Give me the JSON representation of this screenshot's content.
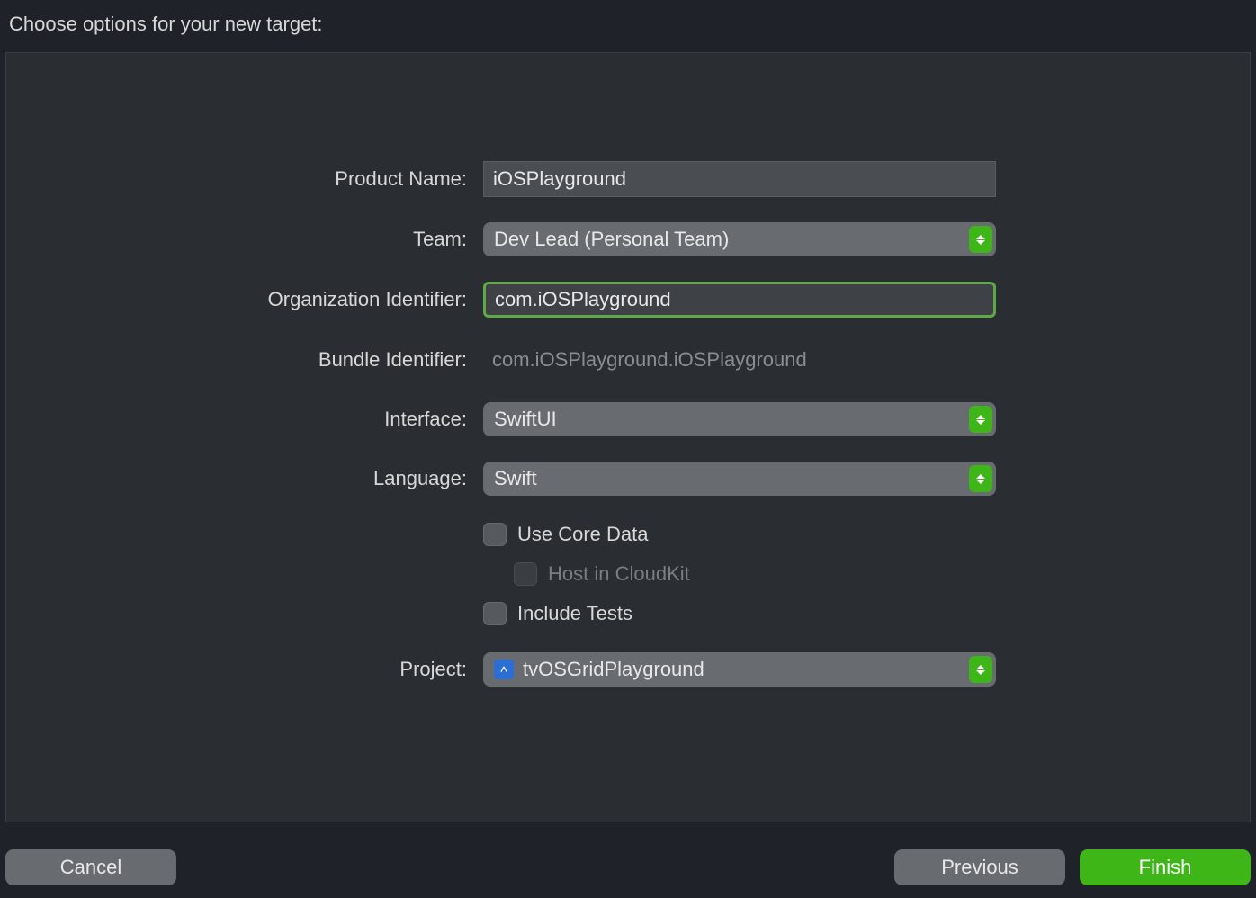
{
  "header": {
    "title": "Choose options for your new target:"
  },
  "form": {
    "productName": {
      "label": "Product Name:",
      "value": "iOSPlayground"
    },
    "team": {
      "label": "Team:",
      "value": "Dev Lead (Personal Team)"
    },
    "orgId": {
      "label": "Organization Identifier:",
      "value": "com.iOSPlayground"
    },
    "bundleId": {
      "label": "Bundle Identifier:",
      "value": "com.iOSPlayground.iOSPlayground"
    },
    "interface": {
      "label": "Interface:",
      "value": "SwiftUI"
    },
    "language": {
      "label": "Language:",
      "value": "Swift"
    },
    "useCoreData": {
      "label": "Use Core Data",
      "checked": false
    },
    "hostCloudKit": {
      "label": "Host in CloudKit",
      "checked": false,
      "disabled": true
    },
    "includeTests": {
      "label": "Include Tests",
      "checked": false
    },
    "project": {
      "label": "Project:",
      "value": "tvOSGridPlayground"
    }
  },
  "footer": {
    "cancel": "Cancel",
    "previous": "Previous",
    "finish": "Finish"
  }
}
